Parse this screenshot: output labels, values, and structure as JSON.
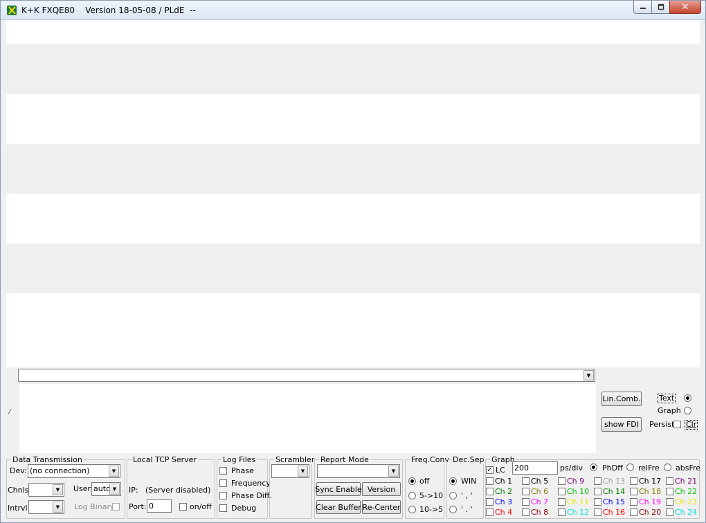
{
  "window": {
    "title": "K+K FXQE80    Version 18-05-08 / PLdE  --",
    "close_glyph": "✕"
  },
  "command_combo": {
    "value": ""
  },
  "right_panel": {
    "lin_comb_label": "Lin.Comb.",
    "show_fdi_label": "show FDI",
    "text_label": "Text",
    "graph_label": "Graph",
    "persist_label": "Persist",
    "clr_label": "Clr"
  },
  "data_transmission": {
    "title": "Data Transmission",
    "dev_label": "Dev:",
    "dev_value": "(no connection)",
    "chnls_label": "Chnls:",
    "user_label": "User:",
    "user_value": "auto",
    "intrvl_label": "Intrvl:",
    "log_binary_label": "Log Binary"
  },
  "tcp_server": {
    "title": "Local TCP Server",
    "ip_label": "IP:",
    "ip_value": "(Server disabled)",
    "port_label": "Port:",
    "port_value": "0",
    "onoff_label": "on/off"
  },
  "log_files": {
    "title": "Log Files",
    "items": [
      "Phase",
      "Frequency",
      "Phase Diff.",
      "Debug"
    ]
  },
  "scrambler": {
    "title": "Scrambler"
  },
  "report_mode": {
    "title": "Report Mode",
    "sync_enable_label": "Sync Enable",
    "version_label": "Version",
    "clear_buffer_label": "Clear Buffer",
    "recenter_label": "Re-Center"
  },
  "freq_conv": {
    "title": "Freq.Conv",
    "options": [
      "off",
      "5->10",
      "10->5"
    ]
  },
  "dec_sep": {
    "title": "Dec.Sep",
    "options": [
      "WIN",
      "' , '",
      "' . '"
    ]
  },
  "graph": {
    "title": "Graph",
    "lc_label": "LC",
    "ps_div_value": "200",
    "ps_div_label": "ps/div",
    "phdff_label": "PhDff",
    "relfre_label": "relFre",
    "absfre_label": "absFre",
    "channels": [
      {
        "label": "Ch 1",
        "color": "#000000"
      },
      {
        "label": "Ch 2",
        "color": "#008000"
      },
      {
        "label": "Ch 3",
        "color": "#0000ff"
      },
      {
        "label": "Ch 4",
        "color": "#ff0000"
      },
      {
        "label": "Ch 5",
        "color": "#000000"
      },
      {
        "label": "Ch 6",
        "color": "#808000"
      },
      {
        "label": "Ch 7",
        "color": "#ff00ff"
      },
      {
        "label": "Ch 8",
        "color": "#800000"
      },
      {
        "label": "Ch 9",
        "color": "#800080"
      },
      {
        "label": "Ch 10",
        "color": "#00c000"
      },
      {
        "label": "Ch 11",
        "color": "#e8e800"
      },
      {
        "label": "Ch 12",
        "color": "#00e0e0"
      },
      {
        "label": "Ch 13",
        "color": "#a0a0a0"
      },
      {
        "label": "Ch 14",
        "color": "#008000"
      },
      {
        "label": "Ch 15",
        "color": "#0000ff"
      },
      {
        "label": "Ch 16",
        "color": "#ff0000"
      },
      {
        "label": "Ch 17",
        "color": "#000000"
      },
      {
        "label": "Ch 18",
        "color": "#808000"
      },
      {
        "label": "Ch 19",
        "color": "#ff00ff"
      },
      {
        "label": "Ch 20",
        "color": "#800000"
      },
      {
        "label": "Ch 21",
        "color": "#800080"
      },
      {
        "label": "Ch 22",
        "color": "#00c000"
      },
      {
        "label": "Ch 23",
        "color": "#e8e800"
      },
      {
        "label": "Ch 24",
        "color": "#00e0e0"
      }
    ]
  }
}
